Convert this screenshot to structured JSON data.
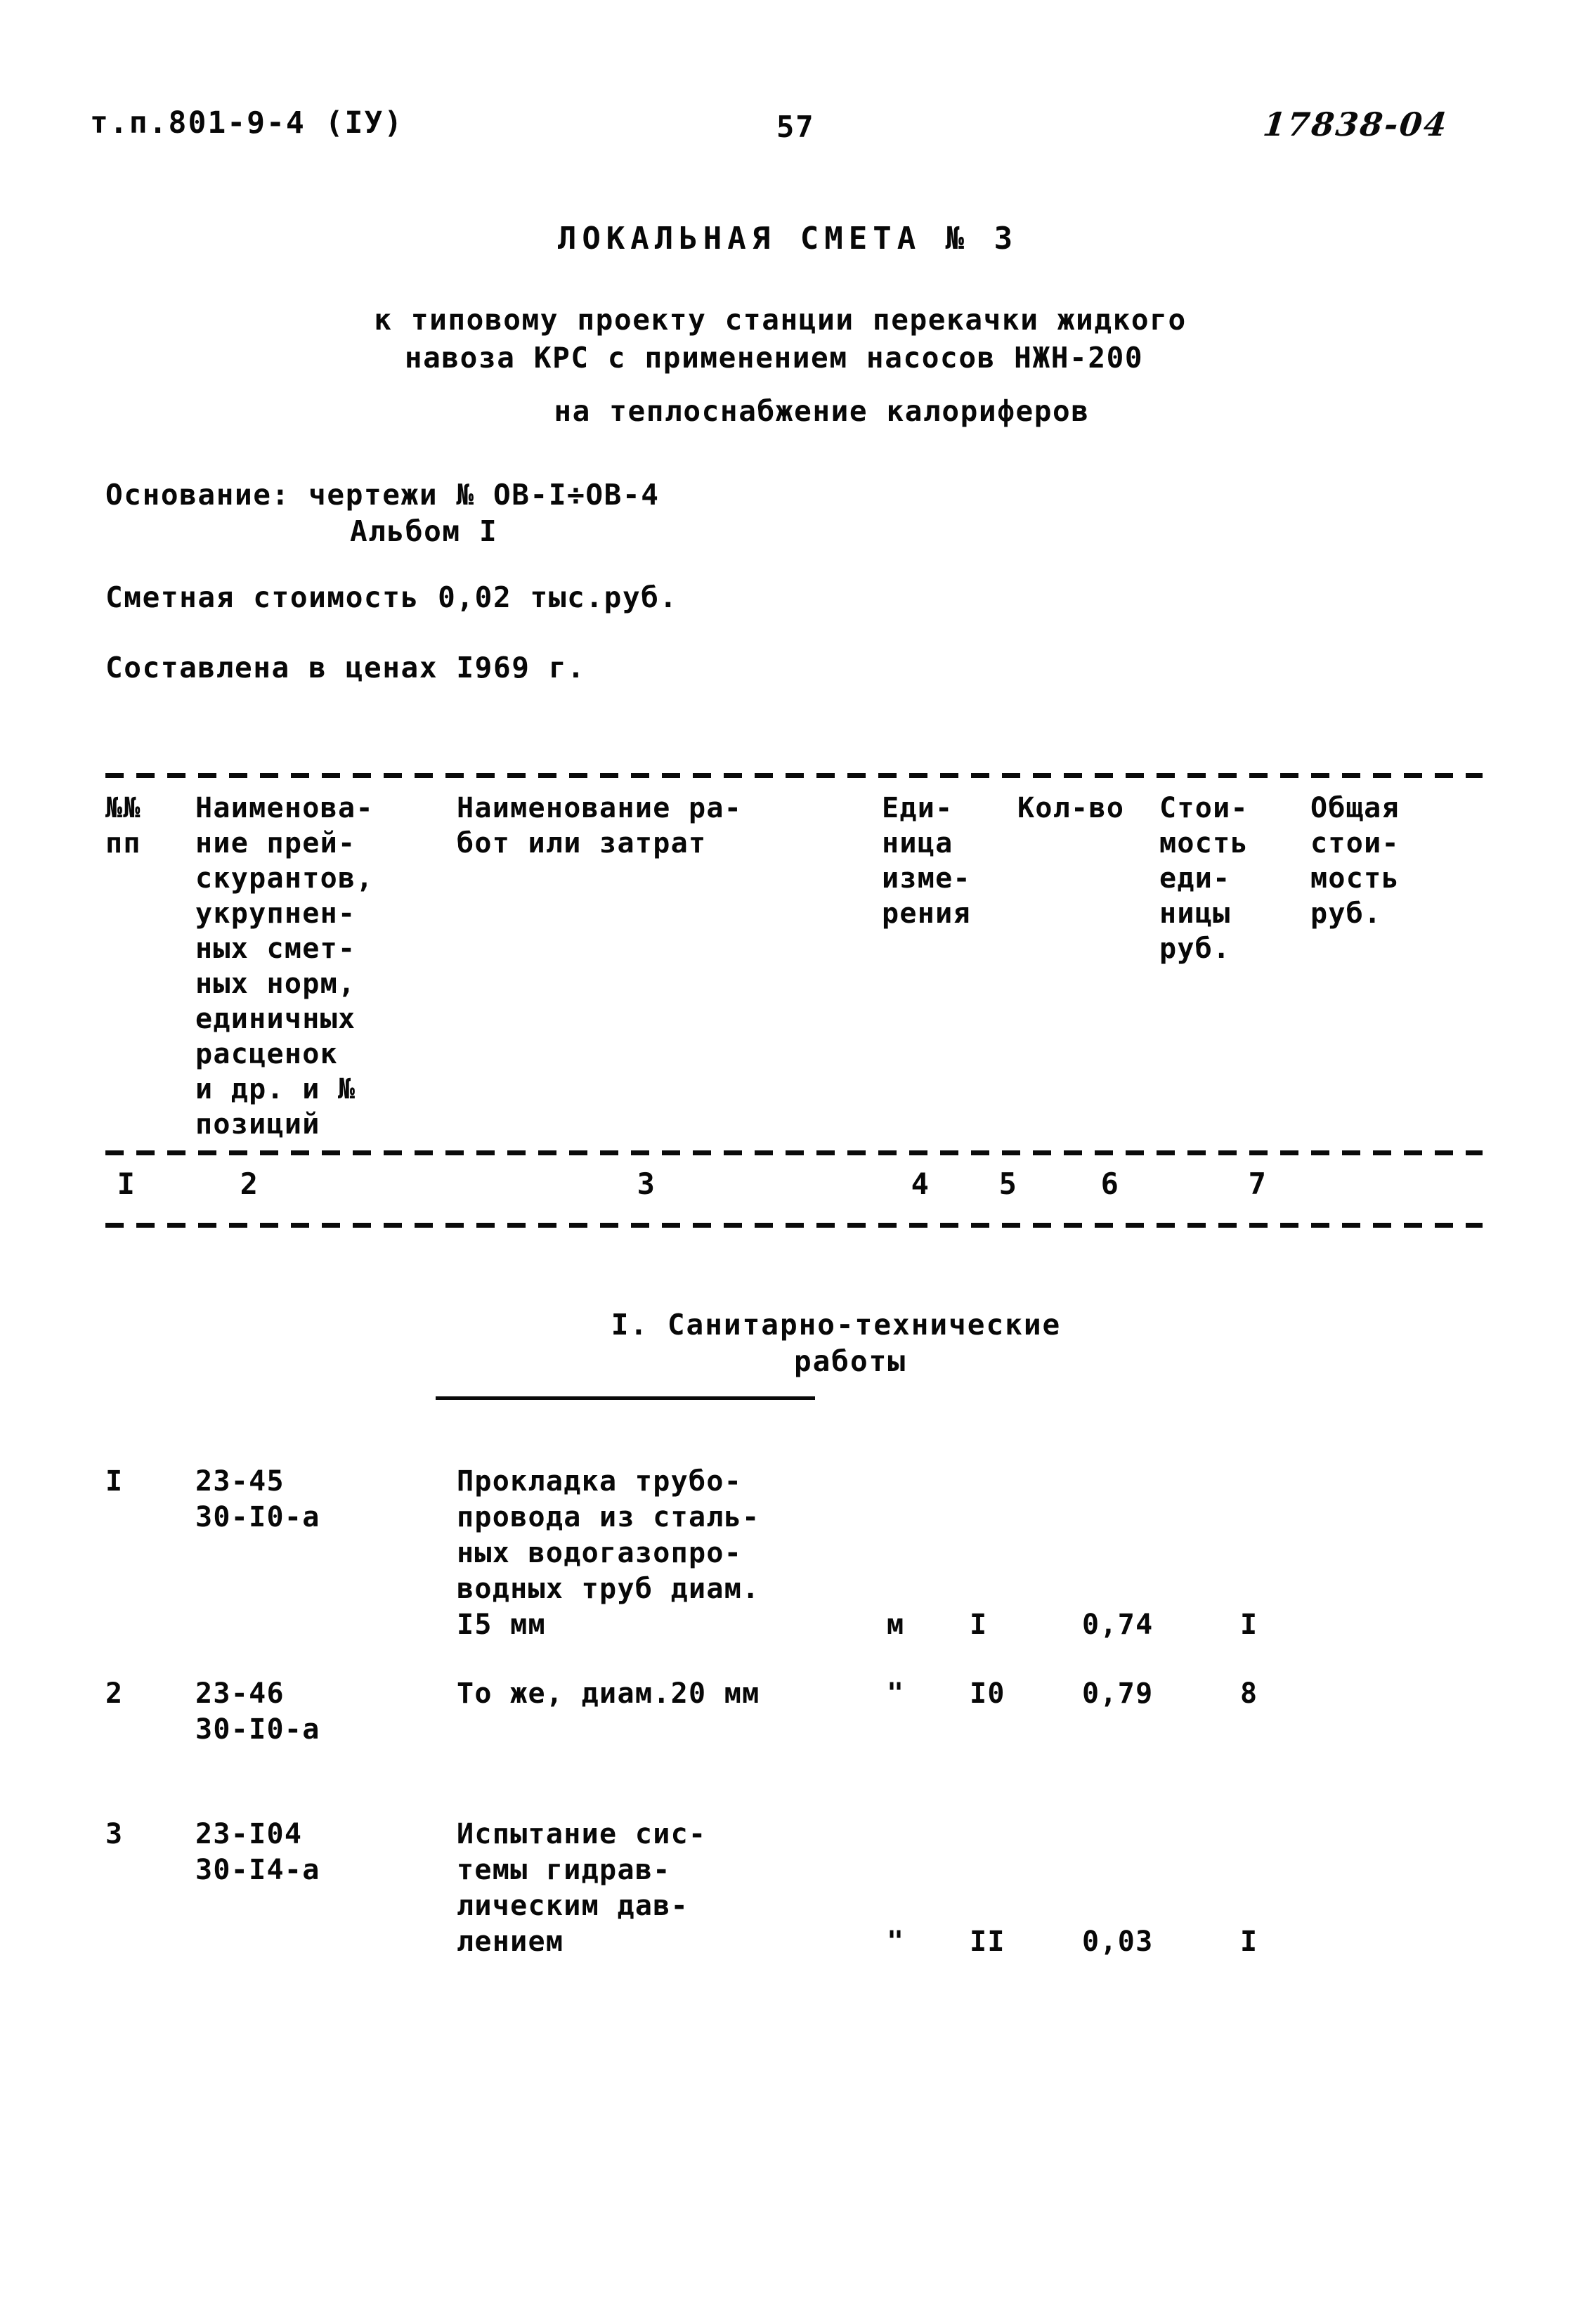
{
  "header": {
    "doc_code": "т.п.801-9-4 (IУ)",
    "page_number": "57",
    "archive_number": "17838-04"
  },
  "title": {
    "main": "ЛОКАЛЬНАЯ СМЕТА № 3",
    "subtitle_line1": "к типовому проекту станции перекачки жидкого",
    "subtitle_line2": "навоза КРС с применением насосов НЖН-200",
    "subtitle_line3": "на теплоснабжение калориферов"
  },
  "meta": {
    "basis_label": "Основание: чертежи № ОВ-I÷ОВ-4",
    "basis_album": "Альбом I",
    "estimate_cost": "Сметная стоимость 0,02 тыс.руб.",
    "price_year": "Составлена в ценах I969 г."
  },
  "table": {
    "headers": {
      "col1": "№№\nпп",
      "col2": "Наименова-\nние прей-\nскурантов,\nукрупнен-\nных смет-\nных норм,\nединичных\nрасценок\nи др. и №\nпозиций",
      "col3": "Наименование ра-\nбот или затрат",
      "col4": "Еди-\nница\nизме-\nрения",
      "col5": "Кол-во",
      "col6": "Стои-\nмость\nеди-\nницы\nруб.",
      "col7": "Общая\nстои-\nмость\nруб."
    },
    "column_numbers": [
      "I",
      "2",
      "3",
      "4",
      "5",
      "6",
      "7"
    ],
    "section_heading_line1": "I. Санитарно-технические",
    "section_heading_line2": "работы",
    "rows": [
      {
        "no": "I",
        "code": "23-45\n30-I0-а",
        "description": "Прокладка трубо-\nпровода из сталь-\nных водогазопро-\nводных труб диам.\nI5 мм",
        "unit": "м",
        "qty": "I",
        "unit_price": "0,74",
        "total": "I"
      },
      {
        "no": "2",
        "code": "23-46\n30-I0-а",
        "description": "То же, диам.20 мм",
        "unit": "\"",
        "qty": "I0",
        "unit_price": "0,79",
        "total": "8"
      },
      {
        "no": "3",
        "code": "23-I04\n30-I4-а",
        "description": "Испытание сис-\nтемы гидрав-\nлическим дав-\nлением",
        "unit": "\"",
        "qty": "II",
        "unit_price": "0,03",
        "total": "I"
      }
    ]
  }
}
